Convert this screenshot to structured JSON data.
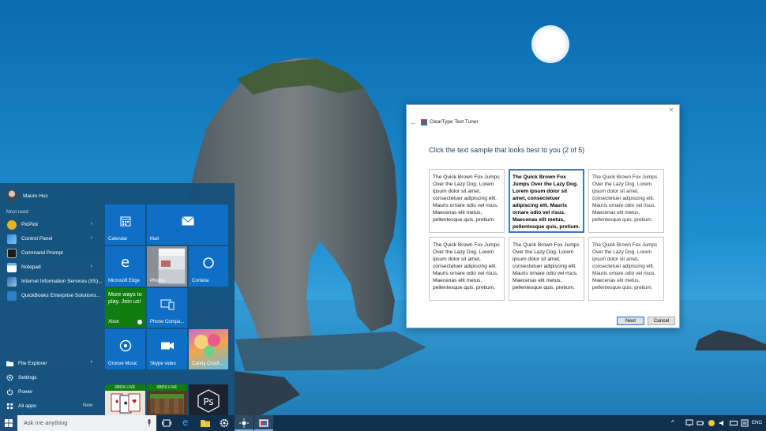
{
  "start_menu": {
    "user_name": "Mauro Huc",
    "most_used_label": "Most used",
    "apps": [
      {
        "label": "PicPick",
        "has_submenu": true,
        "icon": "picpick-icon",
        "color": "#e7b324"
      },
      {
        "label": "Control Panel",
        "has_submenu": true,
        "icon": "control-panel-icon",
        "color": "#3c8fd8"
      },
      {
        "label": "Command Prompt",
        "has_submenu": false,
        "icon": "command-prompt-icon",
        "color": "#1b1b1b"
      },
      {
        "label": "Notepad",
        "has_submenu": true,
        "icon": "notepad-icon",
        "color": "#6fb7e9"
      },
      {
        "label": "Internet Information Services (IIS)...",
        "has_submenu": false,
        "icon": "iis-icon",
        "color": "#2d6db2"
      },
      {
        "label": "QuickBooks Enterprise Solutions...",
        "has_submenu": false,
        "icon": "quickbooks-icon",
        "color": "#2f7fc4"
      }
    ],
    "bottom": {
      "file_explorer": "File Explorer",
      "settings": "Settings",
      "power": "Power",
      "all_apps": "All apps",
      "new_badge": "New"
    },
    "tiles": {
      "calendar": "Calendar",
      "mail": "Mail",
      "edge": "Microsoft Edge",
      "photos": "Photos",
      "cortana": "Cortana",
      "xbox": "Xbox",
      "xbox_promo": "More ways to play. Join us!",
      "phone": "Phone Compa...",
      "groove": "Groove Music",
      "skype": "Skype video",
      "candy": "Candy Crush...",
      "xbox_live_1": "XBOX LIVE",
      "xbox_live_2": "XBOX LIVE"
    },
    "colors": {
      "tile_blue": "#0f6fc6",
      "xbox_green": "#107c10"
    }
  },
  "dialog": {
    "title": "ClearType Text Tuner",
    "heading": "Click the text sample that looks best to you (2 of 5)",
    "sample_text": "The Quick Brown Fox Jumps Over the Lazy Dog. Lorem ipsum dolor sit amet, consectetuer adipiscing elit. Mauris ornare odio vel risus. Maecenas elit metus, pellentesque quis, pretium.",
    "selected_sample": 2,
    "next_label": "Next",
    "cancel_label": "Cancel",
    "colors": {
      "heading": "#1f3f6a",
      "selection_border": "#3a78c2"
    }
  },
  "taskbar": {
    "search_placeholder": "Ask me anything",
    "language": "ENG",
    "colors": {
      "background": "#10314e"
    }
  }
}
